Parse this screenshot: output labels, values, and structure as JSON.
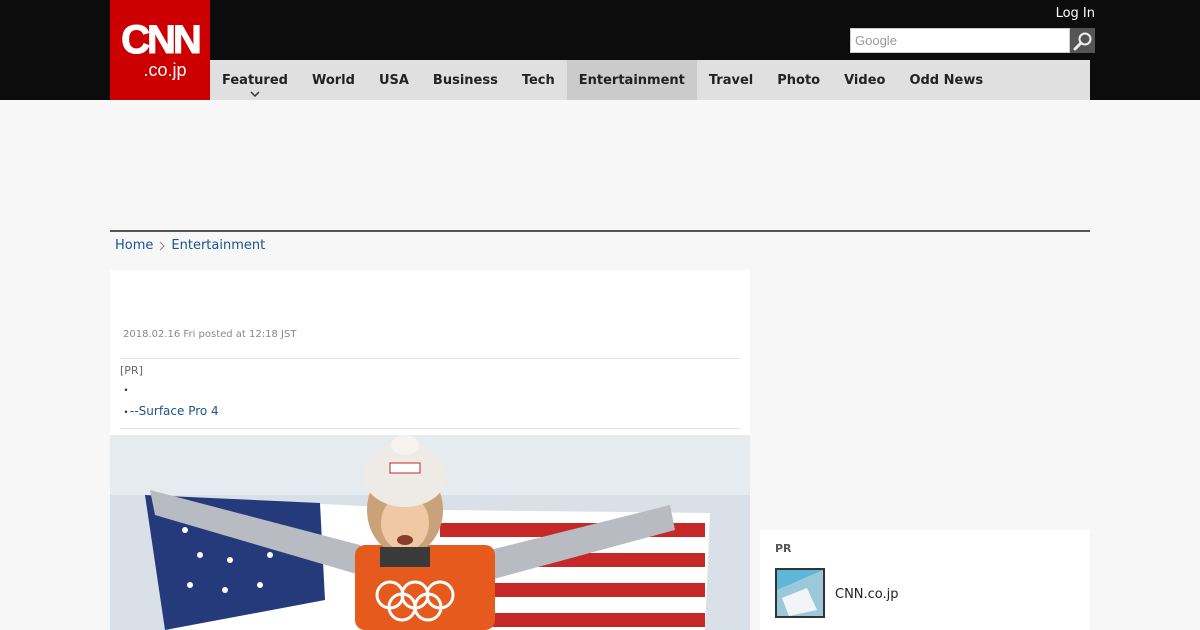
{
  "header": {
    "logo_main": "CNN",
    "logo_sub": ".co.jp",
    "login_label": "Log In",
    "search_placeholder": "Google"
  },
  "nav": {
    "items": [
      "Featured",
      "World",
      "USA",
      "Business",
      "Tech",
      "Entertainment",
      "Travel",
      "Photo",
      "Video",
      "Odd News"
    ],
    "active": "Entertainment"
  },
  "breadcrumb": {
    "home": "Home",
    "section": "Entertainment"
  },
  "article": {
    "dateline": "2018.02.16 Fri posted at 12:18 JST",
    "pr_label": "[PR]",
    "pr_line1": "",
    "pr_line2": "--Surface Pro 4",
    "bullet": "・"
  },
  "sidebar_pr": {
    "title": "PR",
    "item_name": "CNN.co.jp"
  },
  "colors": {
    "brand_red": "#cc0000",
    "topbar": "#0c0c0c",
    "link": "#1a5490"
  }
}
